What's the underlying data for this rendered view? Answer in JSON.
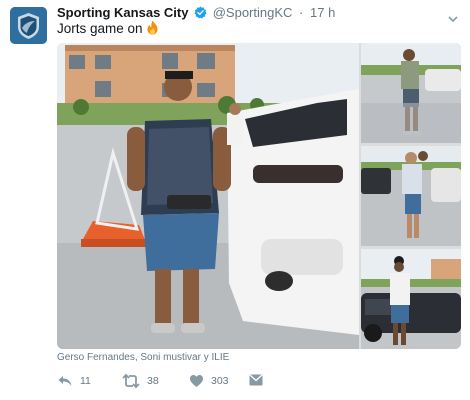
{
  "account": {
    "name": "Sporting Kansas City",
    "handle": "@SportingKC",
    "separator": "·",
    "time": "17 h"
  },
  "tweet": {
    "text": "Jorts game on",
    "caption": "Gerso Fernandes, Soni mustivar y ILIE"
  },
  "actions": {
    "reply_count": "11",
    "retweet_count": "38",
    "like_count": "303"
  },
  "icons": {
    "avatar": "sporting-kc-logo-icon",
    "verified": "verified-badge-icon",
    "emoji": "fire-emoji-icon",
    "caret": "chevron-down-icon",
    "reply": "reply-icon",
    "retweet": "retweet-icon",
    "like": "heart-icon",
    "message": "direct-message-icon"
  },
  "colors": {
    "verified": "#1da1f2",
    "secondary_text": "#657786",
    "avatar_bg": "#2b6a9c"
  }
}
